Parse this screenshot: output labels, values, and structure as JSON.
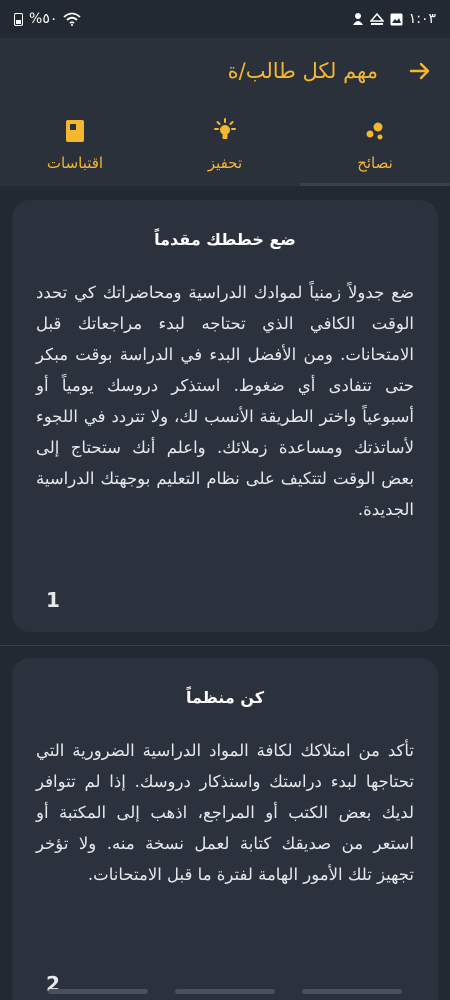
{
  "status_bar": {
    "battery": "%٥٠",
    "time": "١:٠٣"
  },
  "app_bar": {
    "title": "مهم لكل طالب/ة",
    "back_icon": "arrow-right-icon",
    "accent": "#f5b731"
  },
  "tabs": [
    {
      "label": "نصائح",
      "icon": "bubbles-icon",
      "active": true
    },
    {
      "label": "تحفيز",
      "icon": "lightbulb-icon",
      "active": false
    },
    {
      "label": "اقتباسات",
      "icon": "book-icon",
      "active": false
    }
  ],
  "cards": [
    {
      "title": "ضع خططك مقدماً",
      "body": "ضع جدولاً زمنياً لموادك الدراسية ومحاضراتك كي تحدد الوقت الكافي الذي تحتاجه لبدء مراجعاتك قبل الامتحانات. ومن الأفضل البدء في الدراسة بوقت مبكر حتى تتفادى أي ضغوط. استذكر دروسك يومياً أو أسبوعياً واختر الطريقة الأنسب لك، ولا تتردد في اللجوء لأساتذتك ومساعدة زملائك. واعلم أنك ستحتاج إلى بعض الوقت لتتكيف على نظام التعليم بوجهتك الدراسية الجديدة.",
      "number": "1"
    },
    {
      "title": "كن منظماً",
      "body": "تأكد من امتلاكك لكافة المواد الدراسية الضرورية التي تحتاجها لبدء دراستك واستذكار دروسك. إذا لم تتوافر لديك بعض الكتب أو المراجع، اذهب إلى المكتبة أو استعر من صديقك كتابة لعمل نسخة منه. ولا تؤخر تجهيز تلك الأمور الهامة لفترة ما قبل الامتحانات.",
      "number": "2"
    }
  ]
}
